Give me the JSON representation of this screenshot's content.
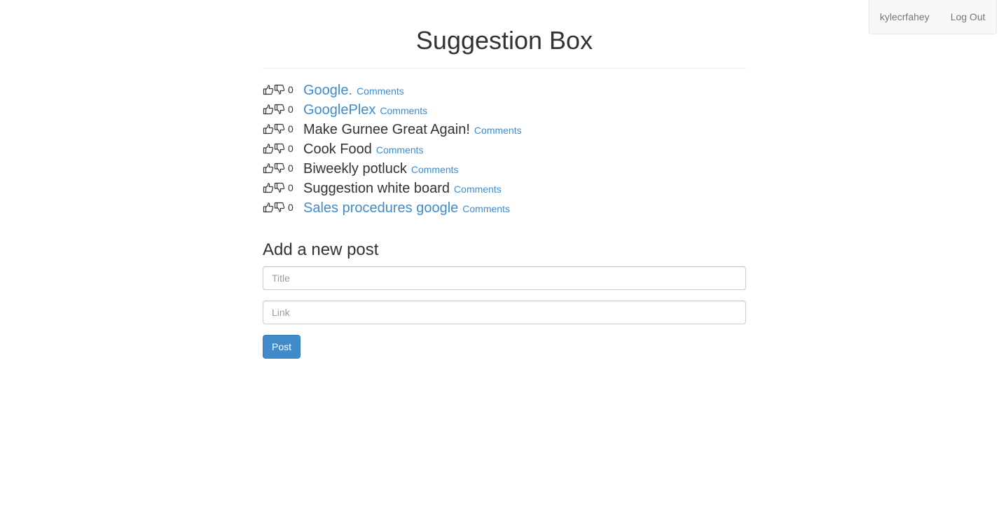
{
  "user_nav": {
    "username": "kylecrfahey",
    "logout_label": "Log Out"
  },
  "page": {
    "title": "Suggestion Box"
  },
  "posts": [
    {
      "votes": "0",
      "title": "Google.",
      "is_link": true,
      "comments_label": "Comments"
    },
    {
      "votes": "0",
      "title": "GooglePlex",
      "is_link": true,
      "comments_label": "Comments"
    },
    {
      "votes": "0",
      "title": "Make Gurnee Great Again!",
      "is_link": false,
      "comments_label": "Comments"
    },
    {
      "votes": "0",
      "title": "Cook Food",
      "is_link": false,
      "comments_label": "Comments"
    },
    {
      "votes": "0",
      "title": "Biweekly potluck",
      "is_link": false,
      "comments_label": "Comments"
    },
    {
      "votes": "0",
      "title": "Suggestion white board",
      "is_link": false,
      "comments_label": "Comments"
    },
    {
      "votes": "0",
      "title": "Sales procedures google",
      "is_link": true,
      "comments_label": "Comments"
    }
  ],
  "new_post_form": {
    "heading": "Add a new post",
    "title_placeholder": "Title",
    "link_placeholder": "Link",
    "submit_label": "Post"
  },
  "icons": {
    "upvote": "thumbs-up-icon",
    "downvote": "thumbs-down-icon"
  },
  "colors": {
    "link": "#428bca",
    "primary_button": "#428bca",
    "text": "#333333"
  }
}
